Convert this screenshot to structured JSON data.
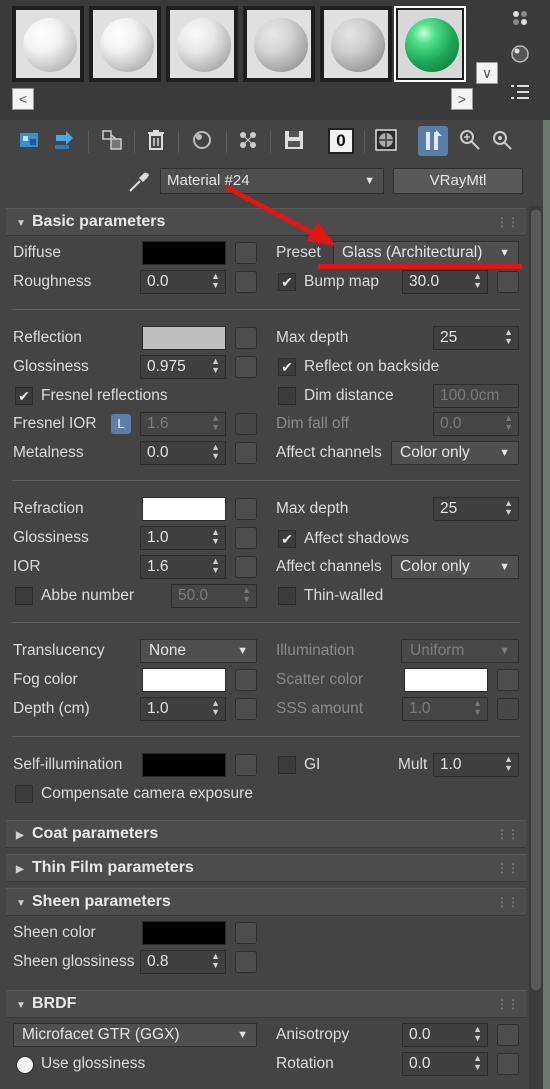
{
  "colors": {
    "accent": "#e01515",
    "glass": "#2ecc71",
    "panel": "#444444"
  },
  "samples": {
    "slots": [
      "white-sphere-1",
      "white-sphere-2",
      "white-sphere-3",
      "grey-sphere-4",
      "grey-sphere-5",
      "green-glass-sphere"
    ],
    "scroll_left": "<",
    "scroll_right": ">",
    "scroll_down": "∨"
  },
  "toolbar": {
    "icons": [
      "get-material-icon",
      "put-to-scene-icon",
      "assign-to-selection-icon",
      "delete-icon",
      "make-unique-icon",
      "put-to-library-icon",
      "save-icon",
      "material-id-icon",
      "show-in-viewport-icon",
      "show-end-result-icon",
      "go-to-parent-icon",
      "go-forward-icon"
    ],
    "material_id": "0"
  },
  "material": {
    "name": "Material #24",
    "type": "VRayMtl"
  },
  "basic": {
    "title": "Basic parameters",
    "diffuse_label": "Diffuse",
    "preset_label": "Preset",
    "preset_value": "Glass (Architectural)",
    "roughness_label": "Roughness",
    "roughness_value": "0.0",
    "bump_label": "Bump map",
    "bump_value": "30.0",
    "reflection_label": "Reflection",
    "max_depth_label": "Max depth",
    "max_depth_value": "25",
    "glossiness_label": "Glossiness",
    "glossiness_value": "0.975",
    "reflect_backside_label": "Reflect on backside",
    "fresnel_label": "Fresnel reflections",
    "dim_distance_label": "Dim distance",
    "dim_distance_value": "100.0cm",
    "fresnel_ior_label": "Fresnel IOR",
    "fresnel_lock": "L",
    "fresnel_ior_value": "1.6",
    "dim_falloff_label": "Dim fall off",
    "dim_falloff_value": "0.0",
    "metalness_label": "Metalness",
    "metalness_value": "0.0",
    "affect_channels_label": "Affect channels",
    "affect_channels_value": "Color only",
    "refraction_label": "Refraction",
    "refr_max_depth_label": "Max depth",
    "refr_max_depth_value": "25",
    "refr_glossiness_label": "Glossiness",
    "refr_glossiness_value": "1.0",
    "affect_shadows_label": "Affect shadows",
    "ior_label": "IOR",
    "ior_value": "1.6",
    "refr_affect_channels_label": "Affect channels",
    "refr_affect_channels_value": "Color only",
    "abbe_label": "Abbe number",
    "abbe_value": "50.0",
    "thin_walled_label": "Thin-walled",
    "translucency_label": "Translucency",
    "translucency_value": "None",
    "illumination_label": "Illumination",
    "illumination_value": "Uniform",
    "fog_color_label": "Fog color",
    "scatter_color_label": "Scatter color",
    "depth_label": "Depth (cm)",
    "depth_value": "1.0",
    "sss_label": "SSS amount",
    "sss_value": "1.0",
    "self_illum_label": "Self-illumination",
    "gi_label": "GI",
    "mult_label": "Mult",
    "mult_value": "1.0",
    "compensate_label": "Compensate camera exposure"
  },
  "coat": {
    "title": "Coat parameters"
  },
  "thinfilm": {
    "title": "Thin Film parameters"
  },
  "sheen": {
    "title": "Sheen parameters",
    "color_label": "Sheen color",
    "glossiness_label": "Sheen glossiness",
    "glossiness_value": "0.8"
  },
  "brdf": {
    "title": "BRDF",
    "type_value": "Microfacet GTR (GGX)",
    "anisotropy_label": "Anisotropy",
    "anisotropy_value": "0.0",
    "use_glossiness_label": "Use glossiness",
    "rotation_label": "Rotation",
    "rotation_value": "0.0"
  }
}
